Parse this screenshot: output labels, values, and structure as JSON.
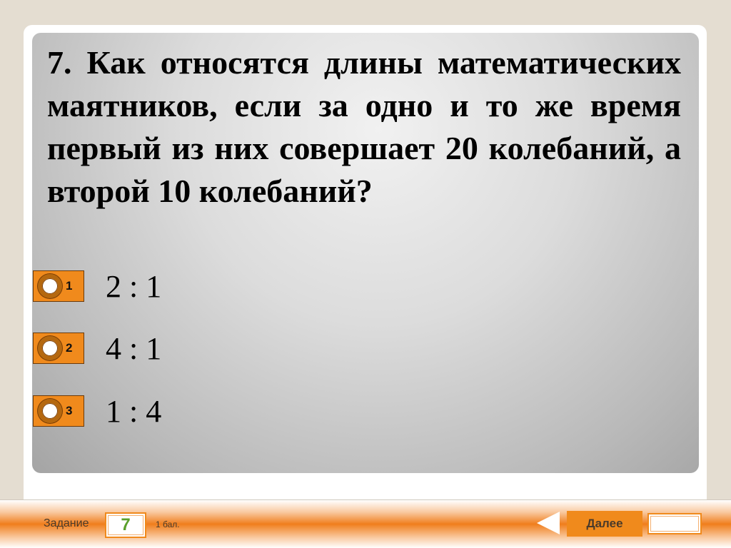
{
  "question": {
    "text": "7. Как относятся длины математических маятников, если за одно и то же время первый из них совершает 20 колебаний, а второй 10 колебаний?"
  },
  "answers": [
    {
      "number": "1",
      "text": "2 : 1"
    },
    {
      "number": "2",
      "text": "4 : 1"
    },
    {
      "number": "3",
      "text": "1 : 4"
    }
  ],
  "footer": {
    "task_label": "Задание",
    "task_number": "7",
    "score": "1 бал.",
    "next_label": "Далее"
  },
  "colors": {
    "accent": "#f08a1c",
    "task_number": "#5aa02c"
  }
}
